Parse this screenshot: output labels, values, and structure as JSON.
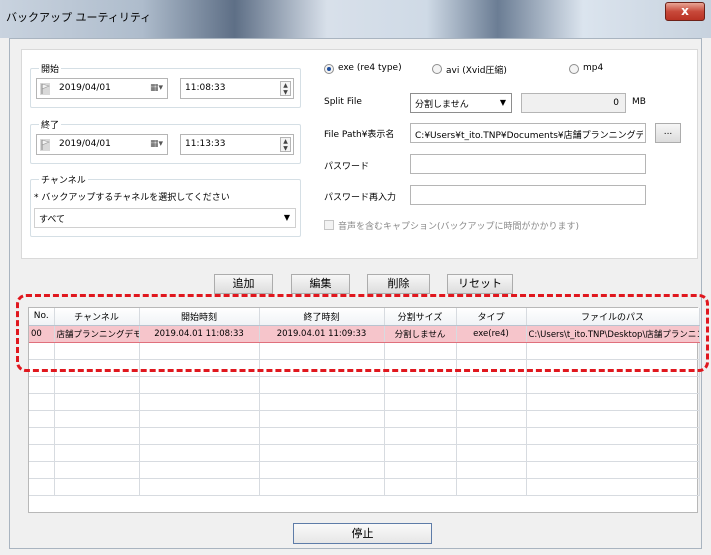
{
  "window": {
    "title": "バックアップ ユーティリティ",
    "close_glyph": "x"
  },
  "start": {
    "legend": "開始",
    "date": "2019/04/01",
    "time": "11:08:33"
  },
  "end": {
    "legend": "終了",
    "date": "2019/04/01",
    "time": "11:13:33"
  },
  "channel": {
    "legend": "チャンネル",
    "hint": "* バックアップするチャネルを選択してください",
    "selected": "すべて"
  },
  "format": {
    "options": [
      {
        "label": "exe (re4 type)",
        "selected": true
      },
      {
        "label": "avi (Xvid圧縮)",
        "selected": false
      },
      {
        "label": "mp4",
        "selected": false
      }
    ]
  },
  "split": {
    "label": "Split File",
    "selected": "分割しません",
    "size": "0",
    "unit": "MB"
  },
  "path": {
    "label": "File Path¥表示名",
    "value": "C:¥Users¥t_ito.TNP¥Documents¥店舗プランニングデモ",
    "browse_label": "..."
  },
  "password": {
    "label": "パスワード",
    "value": ""
  },
  "password_confirm": {
    "label": "パスワード再入力",
    "value": ""
  },
  "audio_caption": {
    "label": "音声を含むキャプション(バックアップに時間がかかります)",
    "checked": false
  },
  "actions": {
    "add": "追加",
    "edit": "編集",
    "delete": "削除",
    "reset": "リセット"
  },
  "table": {
    "headers": [
      "No.",
      "チャンネル",
      "開始時刻",
      "終了時刻",
      "分割サイズ",
      "タイプ",
      "ファイルのパス"
    ],
    "rows": [
      [
        "00",
        "店舗プランニングデモ",
        "2019.04.01 11:08:33",
        "2019.04.01 11:09:33",
        "分割しません",
        "exe(re4)",
        "C:\\Users\\t_ito.TNP\\Desktop\\店舗プランニングデモ"
      ]
    ]
  },
  "stop_label": "停止",
  "colors": {
    "highlight": "#e0171e",
    "selected_row": "#f6c5cb"
  }
}
